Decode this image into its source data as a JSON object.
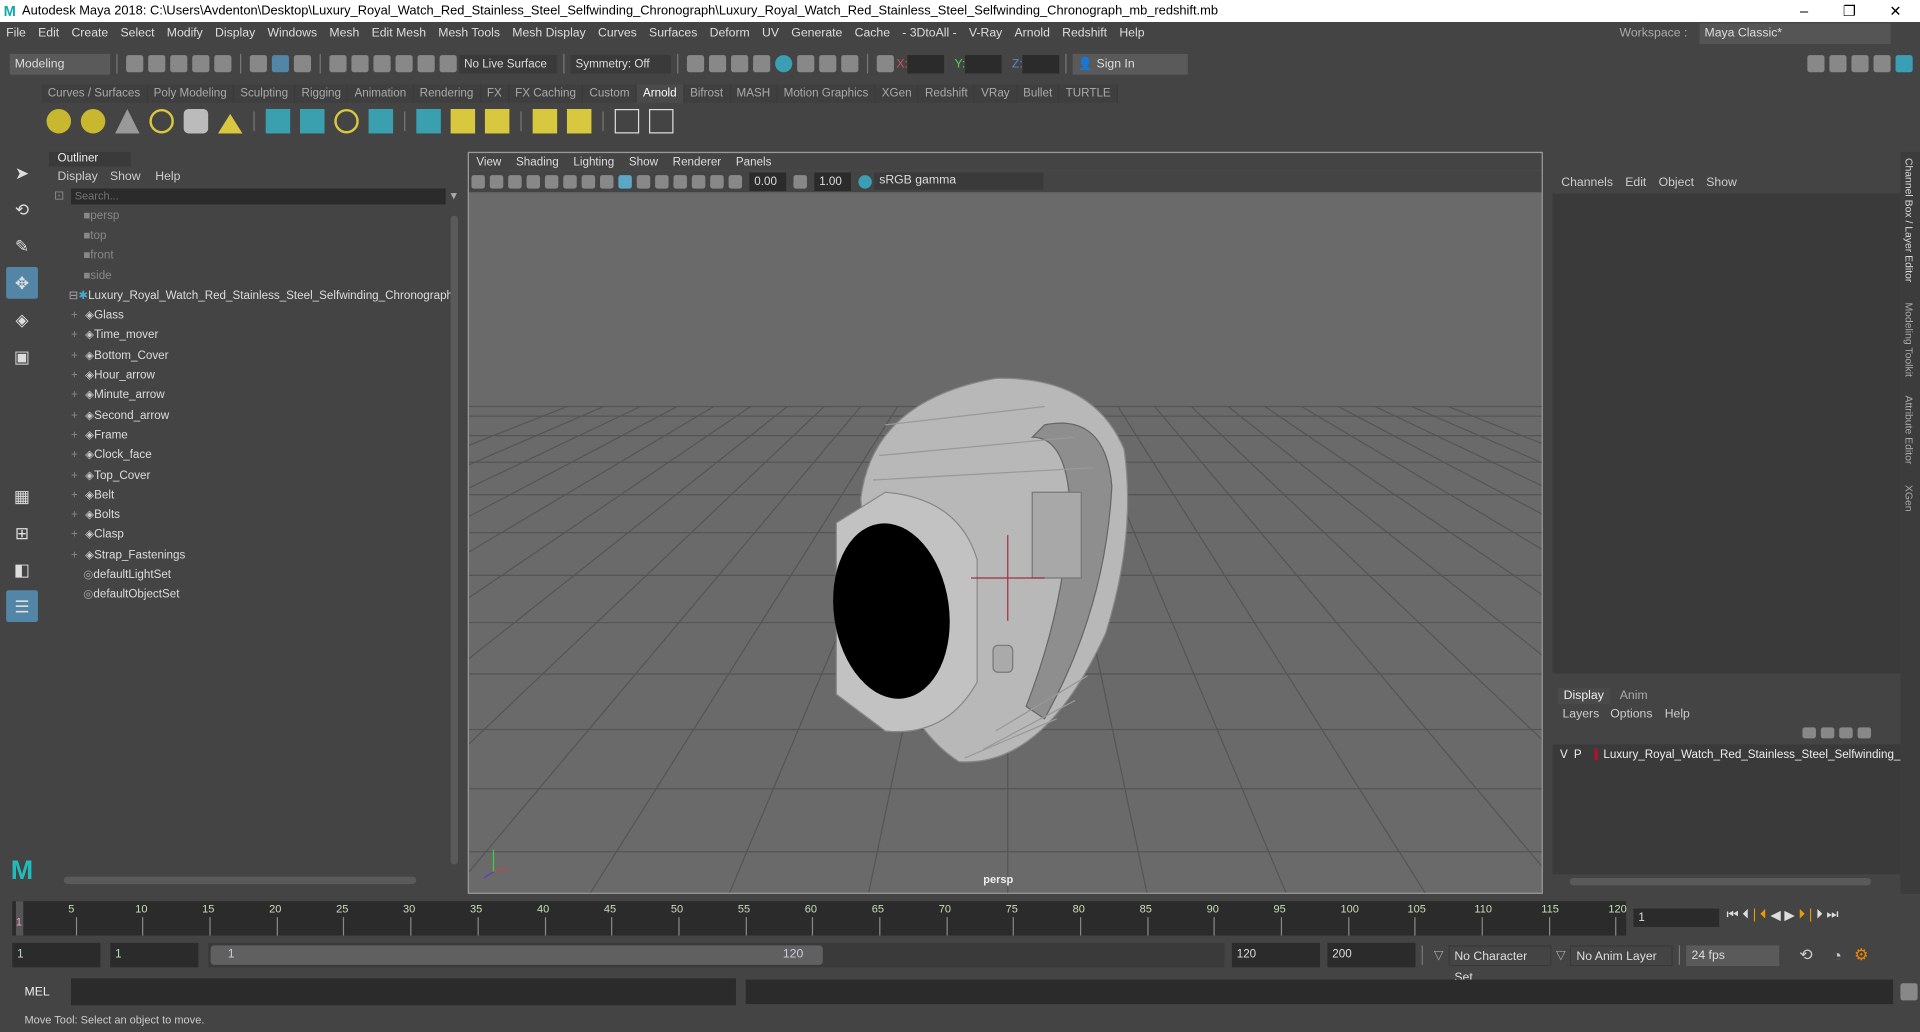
{
  "title": "Autodesk Maya 2018: C:\\Users\\Avdenton\\Desktop\\Luxury_Royal_Watch_Red_Stainless_Steel_Selfwinding_Chronograph\\Luxury_Royal_Watch_Red_Stainless_Steel_Selfwinding_Chronograph_mb_redshift.mb",
  "menu": [
    "File",
    "Edit",
    "Create",
    "Select",
    "Modify",
    "Display",
    "Windows",
    "Mesh",
    "Edit Mesh",
    "Mesh Tools",
    "Mesh Display",
    "Curves",
    "Surfaces",
    "Deform",
    "UV",
    "Generate",
    "Cache",
    "- 3DtoAll -",
    "V-Ray",
    "Arnold",
    "Redshift",
    "Help"
  ],
  "workspace": {
    "label": "Workspace :",
    "value": "Maya Classic*"
  },
  "toolbar": {
    "mode": "Modeling",
    "live_surface": "No Live Surface",
    "symmetry": "Symmetry: Off",
    "x": "X:",
    "y": "Y:",
    "z": "Z:",
    "sign_in": "Sign In"
  },
  "shelf_tabs": [
    "Curves / Surfaces",
    "Poly Modeling",
    "Sculpting",
    "Rigging",
    "Animation",
    "Rendering",
    "FX",
    "FX Caching",
    "Custom",
    "Arnold",
    "Bifrost",
    "MASH",
    "Motion Graphics",
    "XGen",
    "Redshift",
    "VRay",
    "Bullet",
    "TURTLE"
  ],
  "shelf_active": "Arnold",
  "outliner": {
    "title": "Outliner",
    "menu": [
      "Display",
      "Show",
      "Help"
    ],
    "search_placeholder": "Search...",
    "cameras": [
      "persp",
      "top",
      "front",
      "side"
    ],
    "root": "Luxury_Royal_Watch_Red_Stainless_Steel_Selfwinding_Chronograph",
    "children": [
      "Glass",
      "Time_mover",
      "Bottom_Cover",
      "Hour_arrow",
      "Minute_arrow",
      "Second_arrow",
      "Frame",
      "Clock_face",
      "Top_Cover",
      "Belt",
      "Bolts",
      "Clasp",
      "Strap_Fastenings"
    ],
    "sets": [
      "defaultLightSet",
      "defaultObjectSet"
    ]
  },
  "viewport": {
    "menu": [
      "View",
      "Shading",
      "Lighting",
      "Show",
      "Renderer",
      "Panels"
    ],
    "near": "0.00",
    "far": "1.00",
    "color_space": "sRGB gamma",
    "camera_label": "persp"
  },
  "channel_box": {
    "menu": [
      "Channels",
      "Edit",
      "Object",
      "Show"
    ]
  },
  "layer_editor": {
    "tabs": [
      "Display",
      "Anim"
    ],
    "menu": [
      "Layers",
      "Options",
      "Help"
    ],
    "layer": {
      "v": "V",
      "p": "P",
      "name": "Luxury_Royal_Watch_Red_Stainless_Steel_Selfwinding_",
      "color": "#a0182c"
    }
  },
  "side_tabs": [
    "Channel Box / Layer Editor",
    "Modeling Toolkit",
    "Attribute Editor",
    "XGen"
  ],
  "timeline": {
    "ticks": [
      5,
      10,
      15,
      20,
      25,
      30,
      35,
      40,
      45,
      50,
      55,
      60,
      65,
      70,
      75,
      80,
      85,
      90,
      95,
      100,
      105,
      110,
      115,
      120
    ],
    "current": "1",
    "current_field": "1"
  },
  "range": {
    "start": "1",
    "start2": "1",
    "slider_start": "1",
    "slider_end": "120",
    "end": "120",
    "end2": "200",
    "character_set": "No Character Set",
    "anim_layer": "No Anim Layer",
    "fps": "24 fps"
  },
  "mel": {
    "label": "MEL"
  },
  "status": "Move Tool: Select an object to move."
}
